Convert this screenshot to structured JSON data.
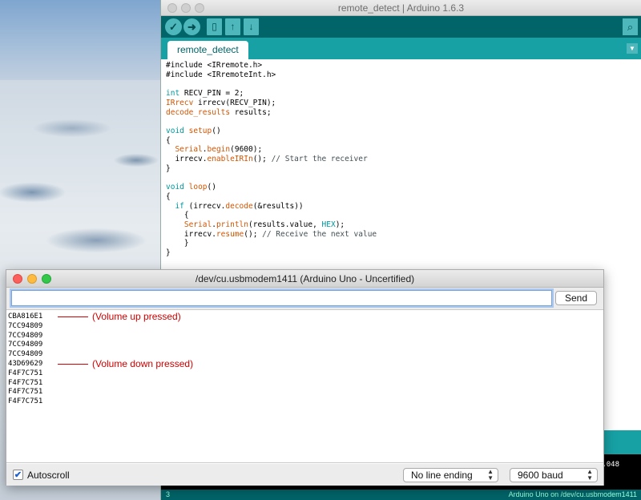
{
  "ide": {
    "title": "remote_detect | Arduino 1.6.3",
    "tab_label": "remote_detect",
    "code_lines": [
      [
        {
          "t": "#include <IRremote.h>",
          "c": ""
        }
      ],
      [
        {
          "t": "#include <IRremoteInt.h>",
          "c": ""
        }
      ],
      [
        {
          "t": "",
          "c": ""
        }
      ],
      [
        {
          "t": "int",
          "c": "kw"
        },
        {
          "t": " RECV_PIN = 2;",
          "c": ""
        }
      ],
      [
        {
          "t": "IRrecv",
          "c": "fn"
        },
        {
          "t": " irrecv(RECV_PIN);",
          "c": ""
        }
      ],
      [
        {
          "t": "decode_results",
          "c": "fn"
        },
        {
          "t": " results;",
          "c": ""
        }
      ],
      [
        {
          "t": "",
          "c": ""
        }
      ],
      [
        {
          "t": "void",
          "c": "kw"
        },
        {
          "t": " ",
          "c": ""
        },
        {
          "t": "setup",
          "c": "fn"
        },
        {
          "t": "()",
          "c": ""
        }
      ],
      [
        {
          "t": "{",
          "c": ""
        }
      ],
      [
        {
          "t": "  ",
          "c": ""
        },
        {
          "t": "Serial",
          "c": "fn"
        },
        {
          "t": ".",
          "c": ""
        },
        {
          "t": "begin",
          "c": "fn"
        },
        {
          "t": "(9600);",
          "c": ""
        }
      ],
      [
        {
          "t": "  irrecv.",
          "c": ""
        },
        {
          "t": "enableIRIn",
          "c": "fn"
        },
        {
          "t": "(); ",
          "c": ""
        },
        {
          "t": "// Start the receiver",
          "c": "cm"
        }
      ],
      [
        {
          "t": "}",
          "c": ""
        }
      ],
      [
        {
          "t": "",
          "c": ""
        }
      ],
      [
        {
          "t": "void",
          "c": "kw"
        },
        {
          "t": " ",
          "c": ""
        },
        {
          "t": "loop",
          "c": "fn"
        },
        {
          "t": "()",
          "c": ""
        }
      ],
      [
        {
          "t": "{",
          "c": ""
        }
      ],
      [
        {
          "t": "  ",
          "c": ""
        },
        {
          "t": "if",
          "c": "kw"
        },
        {
          "t": " (irrecv.",
          "c": ""
        },
        {
          "t": "decode",
          "c": "fn"
        },
        {
          "t": "(&results))",
          "c": ""
        }
      ],
      [
        {
          "t": "    {",
          "c": ""
        }
      ],
      [
        {
          "t": "    ",
          "c": ""
        },
        {
          "t": "Serial",
          "c": "fn"
        },
        {
          "t": ".",
          "c": ""
        },
        {
          "t": "println",
          "c": "fn"
        },
        {
          "t": "(results.value, ",
          "c": ""
        },
        {
          "t": "HEX",
          "c": "kw"
        },
        {
          "t": ");",
          "c": ""
        }
      ],
      [
        {
          "t": "    irrecv.",
          "c": ""
        },
        {
          "t": "resume",
          "c": "fn"
        },
        {
          "t": "(); ",
          "c": ""
        },
        {
          "t": "// Receive the next value",
          "c": "cm"
        }
      ],
      [
        {
          "t": "    }",
          "c": ""
        }
      ],
      [
        {
          "t": "}",
          "c": ""
        }
      ]
    ],
    "console_number": ",048",
    "status_line": "3",
    "status_board": "Arduino Uno on /dev/cu.usbmodem1411",
    "colors": {
      "toolbar": "#006468",
      "tabbar": "#17a1a5",
      "keyword": "#00979c",
      "function": "#d35400"
    }
  },
  "serial": {
    "title": "/dev/cu.usbmodem1411 (Arduino Uno - Uncertified)",
    "input_value": "",
    "send_label": "Send",
    "output_lines": [
      "CBA816E1",
      "7CC94809",
      "7CC94809",
      "7CC94809",
      "7CC94809",
      "43D69629",
      "F4F7C751",
      "F4F7C751",
      "F4F7C751",
      "F4F7C751"
    ],
    "annotations": [
      {
        "text": "(Volume up pressed)",
        "line_index": 0
      },
      {
        "text": "(Volume down pressed)",
        "line_index": 5
      }
    ],
    "autoscroll_label": "Autoscroll",
    "autoscroll_checked": true,
    "line_ending": "No line ending",
    "baud": "9600 baud",
    "annotation_color": "#d20000"
  }
}
